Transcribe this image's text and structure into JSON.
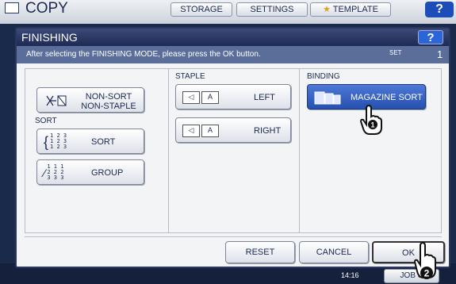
{
  "background": {
    "app_title": "COPY",
    "tabs": [
      "STORAGE",
      "SETTINGS",
      "TEMPLATE"
    ],
    "help": "?",
    "time": "14:16",
    "job_status": "JOB S"
  },
  "dialog": {
    "title": "FINISHING",
    "help": "?",
    "message": "After selecting the FINISHING MODE, please press the OK button.",
    "set_label": "SET",
    "set_count": "1",
    "sections": {
      "sort_label": "SORT",
      "staple_label": "STAPLE",
      "binding_label": "BINDING"
    },
    "buttons": {
      "non_sort": "NON-SORT\nNON-STAPLE",
      "sort": "SORT",
      "group": "GROUP",
      "staple_left": "LEFT",
      "staple_right": "RIGHT",
      "magazine_sort": "MAGAZINE SORT",
      "reset": "RESET",
      "cancel": "CANCEL",
      "ok": "OK"
    },
    "icons": {
      "sort_digits": [
        "1 2 3",
        "1 2 3",
        "1 2 3"
      ],
      "group_digits": [
        "1 1 1",
        "2 2 2",
        "3 3 3"
      ],
      "staple_letter": "A"
    },
    "callouts": [
      "1",
      "2"
    ]
  },
  "colors": {
    "accent": "#2651b0",
    "title_bar": "#1e2a55",
    "message_bar": "#5b6e9a"
  }
}
